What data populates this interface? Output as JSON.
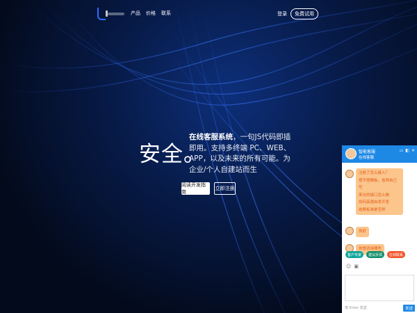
{
  "colors": {
    "accent": "#1e88e5",
    "bubble_bg": "#fbc58c",
    "bubble_text": "#e65a14",
    "btn_green": "#11a59a",
    "btn_teal": "#128f6b",
    "btn_orange": "#f2552c"
  },
  "nav": {
    "menu": [
      "产品",
      "价格",
      "联系"
    ],
    "login": "登录",
    "trial": "免费试用"
  },
  "hero": {
    "big": "安全。",
    "line_bold": "在线客服系统",
    "line_rest": "，一句JS代码即插即用。支持多终端 PC、WEB、APP，以及未来的所有可能。为企业/个人自建站而生",
    "btn_docs": "阅读开发指南",
    "btn_register": "立即注册"
  },
  "chat": {
    "agent_name": "智能客服",
    "agent_status": "在线客服",
    "header_icons": [
      "minimize-icon",
      "expand-icon",
      "close-icon"
    ],
    "faq": [
      "注册了怎么接入？",
      "搭不搭模板，省得自己写",
      "来访的接口怎么做",
      "如何高速启发开发",
      "收费标准是怎样"
    ],
    "msg_hello": "你好",
    "msg_other": "你想咨询哪些",
    "quick_buttons": [
      "客户专家",
      "建议反馈",
      "在线联系"
    ],
    "input_hint": "按 Enter 发送",
    "send": "发送"
  }
}
